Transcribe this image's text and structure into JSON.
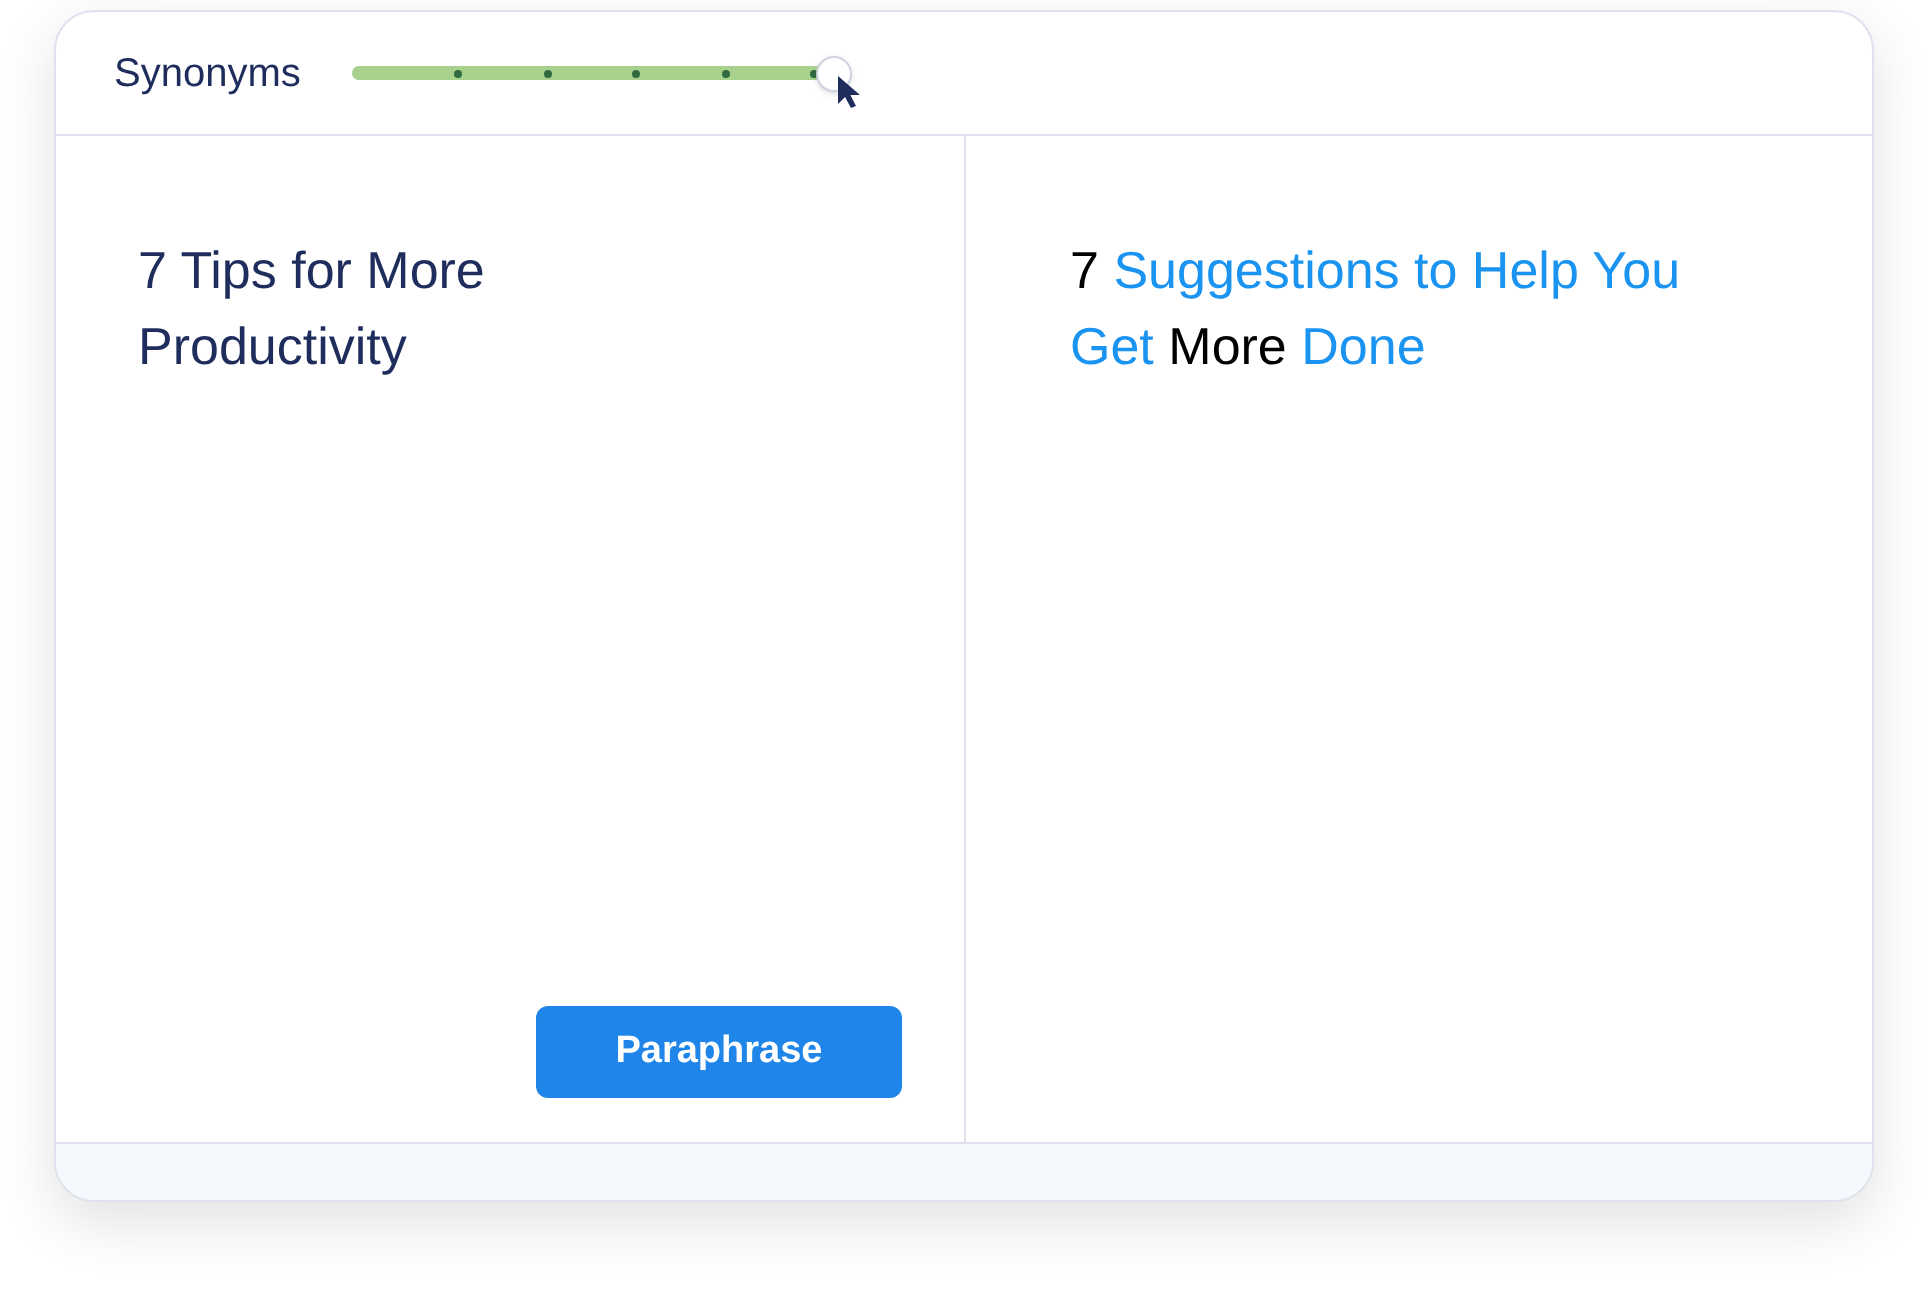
{
  "toolbar": {
    "label": "Synonyms",
    "slider": {
      "level": 1
    }
  },
  "input": {
    "text": "7 Tips for More Productivity",
    "button": "Paraphrase"
  },
  "output": {
    "segments": [
      {
        "text": "7",
        "changed": false
      },
      {
        "text": "Suggestions to Help You Get",
        "changed": true
      },
      {
        "text": "More",
        "changed": false
      },
      {
        "text": "Done",
        "changed": true
      }
    ]
  }
}
